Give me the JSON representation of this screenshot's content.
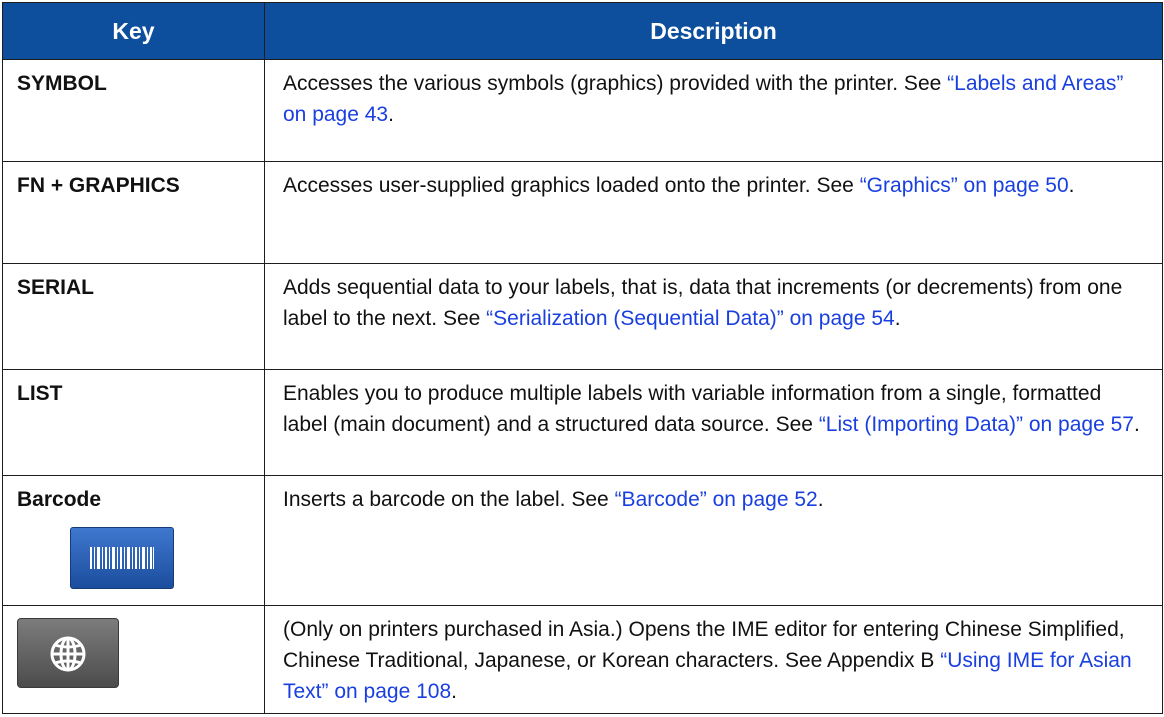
{
  "header": {
    "key": "Key",
    "description": "Description"
  },
  "rows": [
    {
      "key": "SYMBOL",
      "desc": "Accesses the various symbols (graphics) provided with the printer. See ",
      "link": "“Labels and Areas” on page 43",
      "after": "."
    },
    {
      "key": "FN + GRAPHICS",
      "desc": "Accesses user-supplied graphics loaded onto the printer. See ",
      "link": "“Graphics” on page 50",
      "after": "."
    },
    {
      "key": "SERIAL",
      "desc": "Adds sequential data to your labels, that is, data that increments (or decrements) from one label to the next. See ",
      "link": "“Serialization (Sequential Data)” on page 54",
      "after": "."
    },
    {
      "key": "LIST",
      "desc": "Enables you to produce multiple labels with variable information from a single, formatted label (main document) and a structured data source. See ",
      "link": "“List (Importing Data)” on page 57",
      "after": "."
    },
    {
      "key": "Barcode",
      "key_icon": "barcode-icon",
      "desc": "Inserts a barcode on the label. See ",
      "link": "“Barcode” on page 52",
      "after": "."
    },
    {
      "key_icon": "globe-icon",
      "desc": "(Only on printers purchased in Asia.) Opens the IME editor for entering Chinese Simplified, Chinese Traditional, Japanese, or Korean characters. See Appendix B ",
      "link": "“Using IME for Asian Text” on page 108",
      "after": "."
    }
  ],
  "colors": {
    "header_bg": "#0d4f9c",
    "link": "#1a3fe0",
    "border": "#1d1d1d"
  }
}
